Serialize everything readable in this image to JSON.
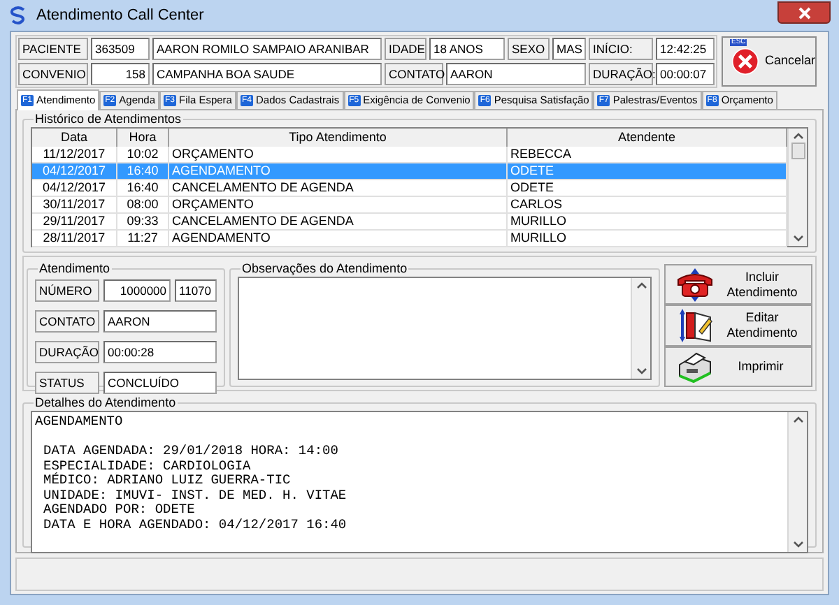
{
  "window": {
    "title": "Atendimento Call Center"
  },
  "header": {
    "paciente_label": "PACIENTE",
    "paciente_id": "363509",
    "paciente_nome": "AARON ROMILO SAMPAIO ARANIBAR",
    "idade_label": "IDADE",
    "idade": "18 ANOS",
    "sexo_label": "SEXO",
    "sexo": "MAS",
    "inicio_label": "INÍCIO:",
    "inicio": "12:42:25",
    "convenio_label": "CONVENIO",
    "convenio_id": "158",
    "convenio_nome": "CAMPANHA BOA SAUDE",
    "contato_label": "CONTATO",
    "contato": "AARON",
    "duracao_label": "DURAÇÃO:",
    "duracao": "00:00:07"
  },
  "cancel_button": {
    "badge": "ESC",
    "label": "Cancelar"
  },
  "tabs": [
    {
      "key": "F1",
      "label": "Atendimento",
      "selected": true
    },
    {
      "key": "F2",
      "label": "Agenda",
      "selected": false
    },
    {
      "key": "F3",
      "label": "Fila Espera",
      "selected": false
    },
    {
      "key": "F4",
      "label": "Dados Cadastrais",
      "selected": false
    },
    {
      "key": "F5",
      "label": "Exigência de Convenio",
      "selected": false
    },
    {
      "key": "F6",
      "label": "Pesquisa Satisfação",
      "selected": false
    },
    {
      "key": "F7",
      "label": "Palestras/Eventos",
      "selected": false
    },
    {
      "key": "F8",
      "label": "Orçamento",
      "selected": false
    }
  ],
  "historico": {
    "title": "Histórico de Atendimentos",
    "columns": [
      "Data",
      "Hora",
      "Tipo Atendimento",
      "Atendente"
    ],
    "rows": [
      {
        "cells": [
          "11/12/2017",
          "10:02",
          "ORÇAMENTO",
          "REBECCA"
        ],
        "selected": false
      },
      {
        "cells": [
          "04/12/2017",
          "16:40",
          "AGENDAMENTO",
          "ODETE"
        ],
        "selected": true
      },
      {
        "cells": [
          "04/12/2017",
          "16:40",
          "CANCELAMENTO DE AGENDA",
          "ODETE"
        ],
        "selected": false
      },
      {
        "cells": [
          "30/11/2017",
          "08:00",
          "ORÇAMENTO",
          "CARLOS"
        ],
        "selected": false
      },
      {
        "cells": [
          "29/11/2017",
          "09:33",
          "CANCELAMENTO DE AGENDA",
          "MURILLO"
        ],
        "selected": false
      },
      {
        "cells": [
          "28/11/2017",
          "11:27",
          "AGENDAMENTO",
          "MURILLO"
        ],
        "selected": false
      }
    ]
  },
  "atendimento": {
    "title": "Atendimento",
    "fields": [
      {
        "label": "NÚMERO",
        "values": [
          "1000000",
          "11070"
        ]
      },
      {
        "label": "CONTATO",
        "values": [
          "AARON"
        ]
      },
      {
        "label": "DURAÇÃO",
        "values": [
          "00:00:28"
        ]
      },
      {
        "label": "STATUS",
        "values": [
          "CONCLUÍDO"
        ]
      }
    ]
  },
  "observacoes": {
    "title": "Observações do Atendimento"
  },
  "actions": [
    {
      "kind": "add",
      "label": [
        "Incluir",
        "Atendimento"
      ]
    },
    {
      "kind": "edit",
      "label": [
        "Editar",
        "Atendimento"
      ]
    },
    {
      "kind": "print",
      "label": [
        "Imprimir"
      ]
    }
  ],
  "detalhes": {
    "title": "Detalhes do Atendimento",
    "heading": "AGENDAMENTO",
    "lines": [
      "DATA AGENDADA: 29/01/2018 HORA: 14:00",
      "ESPECIALIDADE: CARDIOLOGIA",
      "MÉDICO: ADRIANO LUIZ GUERRA-TIC",
      "UNIDADE: IMUVI- INST. DE MED. H. VITAE",
      "AGENDADO POR: ODETE",
      "DATA E HORA AGENDADO: 04/12/2017 16:40"
    ]
  }
}
